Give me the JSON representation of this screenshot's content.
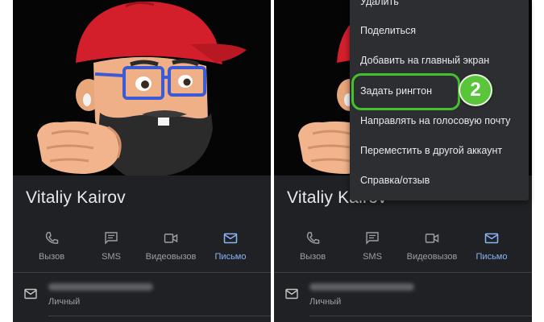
{
  "contact": {
    "name": "Vitaliy Kairov",
    "email_type": "Личный"
  },
  "actions": [
    {
      "label": "Вызов",
      "icon": "phone-icon"
    },
    {
      "label": "SMS",
      "icon": "sms-icon"
    },
    {
      "label": "Видеовызов",
      "icon": "video-icon"
    },
    {
      "label": "Письмо",
      "icon": "mail-icon"
    }
  ],
  "menu": {
    "items": [
      "Удалить",
      "Поделиться",
      "Добавить на главный экран",
      "Задать рингтон",
      "Направлять на голосовую почту",
      "Переместить в другой аккаунт",
      "Справка/отзыв"
    ],
    "highlighted_index": 3
  },
  "step_badge": "2",
  "colors": {
    "background": "#202124",
    "menu_background": "#2d2e31",
    "accent": "#8ab4f8",
    "highlight": "#43c22e",
    "text_primary": "#e8eaed",
    "text_secondary": "#9aa0a6"
  }
}
